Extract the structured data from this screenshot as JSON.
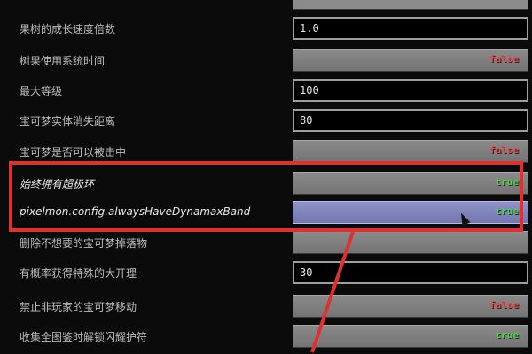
{
  "rows": [
    {
      "label": "果树的成长速度倍数",
      "type": "text",
      "value": "1.0"
    },
    {
      "label": "树果使用系统时间",
      "type": "toggle",
      "value": "false"
    },
    {
      "label": "最大等级",
      "type": "text",
      "value": "100"
    },
    {
      "label": "宝可梦实体消失距离",
      "type": "text",
      "value": "80"
    },
    {
      "label": "宝可梦是否可以被击中",
      "type": "toggle",
      "value": "false"
    },
    {
      "label": "始终拥有超极环",
      "type": "toggle",
      "value": "true"
    },
    {
      "label": "pixelmon.config.alwaysHaveDynamaxBand",
      "type": "toggle",
      "value": "true"
    },
    {
      "label": "删除不想要的宝可梦掉落物",
      "type": "toggle",
      "value": ""
    },
    {
      "label": "有概率获得特殊的大开理",
      "type": "text",
      "value": "30"
    },
    {
      "label": "禁止非玩家的宝可梦移动",
      "type": "toggle",
      "value": "false"
    },
    {
      "label": "收集全图鉴时解锁闪耀护符",
      "type": "toggle",
      "value": "true"
    }
  ],
  "colors": {
    "highlight_border": "#e03030",
    "false": "#e84a4a",
    "true": "#48d848",
    "hover_button": "#8e92c8"
  }
}
